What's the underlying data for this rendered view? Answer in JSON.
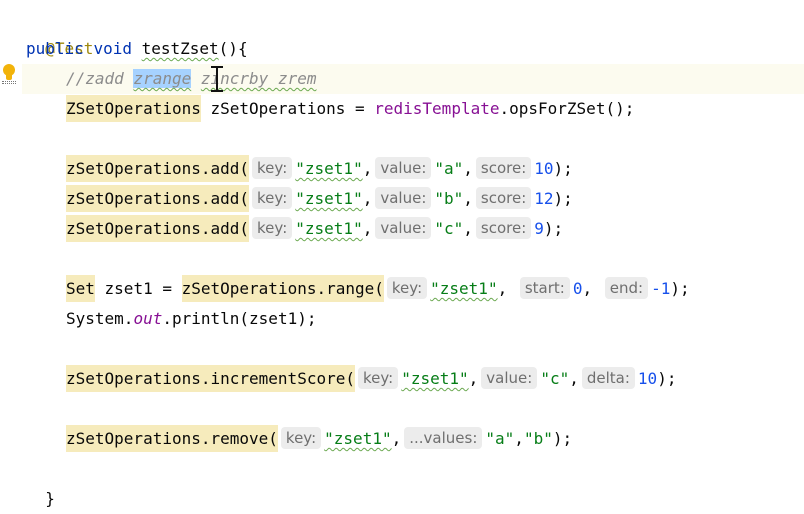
{
  "editor": {
    "language": "java",
    "lines": {
      "annotation": "@Test",
      "method_sig": {
        "kw_public": "public",
        "kw_void": "void",
        "name": "testZset",
        "rest": "(){"
      },
      "comment": {
        "prefix": "//zadd ",
        "selected": "zrange",
        "space": " ",
        "rest": "zincrby zrem"
      },
      "ops_decl": {
        "type": "ZSetOperations",
        "middle": " zSetOperations = ",
        "target": "redisTemplate",
        "call": ".opsForZSet();"
      },
      "add_calls": [
        {
          "receiver": "zSetOperations.add(",
          "key_hint": "key:",
          "key": "\"zset1\"",
          "value_hint": "value:",
          "value": "\"a\"",
          "score_hint": "score:",
          "score": "10",
          "end": ");"
        },
        {
          "receiver": "zSetOperations.add(",
          "key_hint": "key:",
          "key": "\"zset1\"",
          "value_hint": "value:",
          "value": "\"b\"",
          "score_hint": "score:",
          "score": "12",
          "end": ");"
        },
        {
          "receiver": "zSetOperations.add(",
          "key_hint": "key:",
          "key": "\"zset1\"",
          "value_hint": "value:",
          "value": "\"c\"",
          "score_hint": "score:",
          "score": "9",
          "end": ");"
        }
      ],
      "range": {
        "type": "Set",
        "middle": " zset1 = ",
        "receiver": "zSetOperations.range(",
        "key_hint": "key:",
        "key": "\"zset1\"",
        "start_hint": "start:",
        "start": "0",
        "end_hint": "end:",
        "end": "-1",
        "close": ");"
      },
      "println": {
        "prefix": "System.",
        "field": "out",
        "rest": ".println(zset1);"
      },
      "increment": {
        "receiver": "zSetOperations.incrementScore(",
        "key_hint": "key:",
        "key": "\"zset1\"",
        "value_hint": "value:",
        "value": "\"c\"",
        "delta_hint": "delta:",
        "delta": "10",
        "close": ");"
      },
      "remove": {
        "receiver": "zSetOperations.remove(",
        "key_hint": "key:",
        "key": "\"zset1\"",
        "values_hint": "...values:",
        "value_a": "\"a\"",
        "value_b": "\"b\"",
        "close": ");"
      },
      "closing_brace": "}"
    }
  },
  "icons": {
    "gutter": "lightbulb-icon",
    "cursor": "text-cursor-icon"
  },
  "colors": {
    "keyword": "#0033b3",
    "string": "#067d17",
    "number": "#1750eb",
    "comment": "#8c8c8c",
    "annotation": "#9e880d",
    "warning_bg": "#f6ebbc",
    "selection": "#a6d2ff"
  }
}
